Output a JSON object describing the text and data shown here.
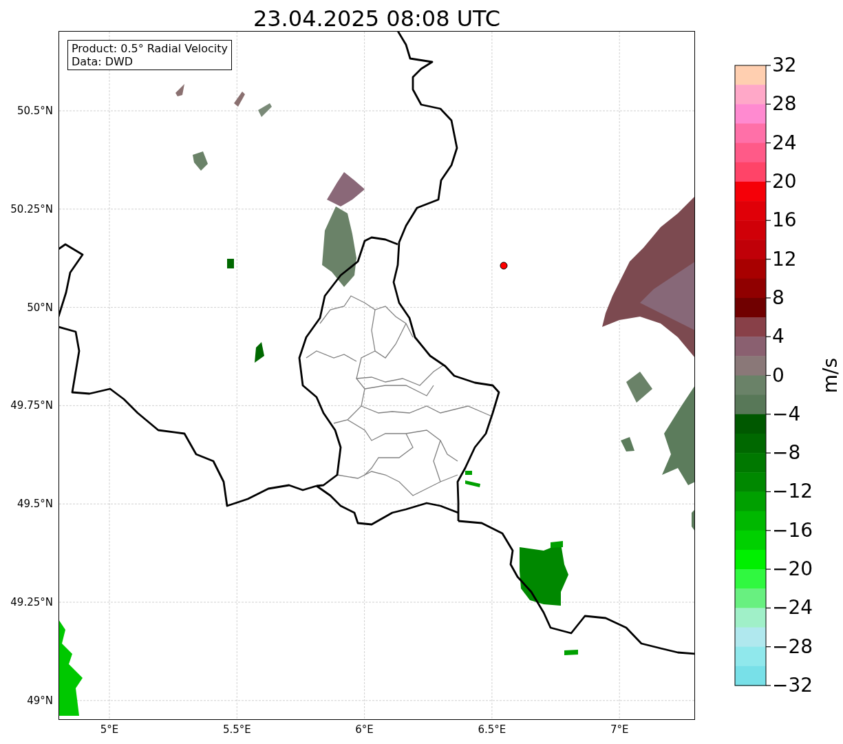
{
  "title": "23.04.2025 08:08 UTC",
  "info_box": {
    "lines": [
      "Product: 0.5° Radial Velocity",
      "Data: DWD"
    ]
  },
  "map": {
    "lat_ticks": [
      "50.5°N",
      "50.25°N",
      "50°N",
      "49.75°N",
      "49.5°N",
      "49.25°N",
      "49°N"
    ],
    "lon_ticks": [
      "5°E",
      "5.5°E",
      "6°E",
      "6.5°E",
      "7°E"
    ]
  },
  "colorbar": {
    "label": "m/s",
    "ticks": [
      "32",
      "28",
      "24",
      "20",
      "16",
      "12",
      "8",
      "4",
      "0",
      "−4",
      "−8",
      "−12",
      "−16",
      "−20",
      "−24",
      "−28",
      "−32"
    ],
    "bins": [
      {
        "color": "#ffcfb0"
      },
      {
        "color": "#ffa8c8"
      },
      {
        "color": "#ff8ad0"
      },
      {
        "color": "#ff70a8"
      },
      {
        "color": "#ff5a88"
      },
      {
        "color": "#ff4468"
      },
      {
        "color": "#f50008"
      },
      {
        "color": "#e00008"
      },
      {
        "color": "#d00008"
      },
      {
        "color": "#c00008"
      },
      {
        "color": "#a80000"
      },
      {
        "color": "#900000"
      },
      {
        "color": "#700000"
      },
      {
        "color": "#884048"
      },
      {
        "color": "#8a6070"
      },
      {
        "color": "#8a7878"
      },
      {
        "color": "#6a8268"
      },
      {
        "color": "#587858"
      },
      {
        "color": "#005800"
      },
      {
        "color": "#006800"
      },
      {
        "color": "#007800"
      },
      {
        "color": "#008800"
      },
      {
        "color": "#00a000"
      },
      {
        "color": "#00b800"
      },
      {
        "color": "#00d000"
      },
      {
        "color": "#00f000"
      },
      {
        "color": "#30f840"
      },
      {
        "color": "#68f080"
      },
      {
        "color": "#a0f0c8"
      },
      {
        "color": "#b0e8ee"
      },
      {
        "color": "#90e8ec"
      },
      {
        "color": "#78e0e8"
      }
    ]
  }
}
